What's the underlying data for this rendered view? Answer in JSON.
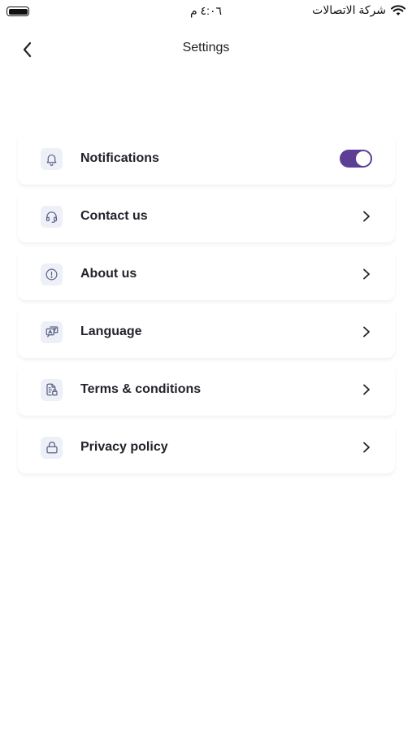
{
  "status_bar": {
    "time": "٤:٠٦ م",
    "carrier": "شركة الاتصالات"
  },
  "header": {
    "title": "Settings"
  },
  "colors": {
    "accent": "#5c3e95",
    "icon_bg": "#eef0f8",
    "icon_stroke": "#5a5f86"
  },
  "settings": {
    "items": [
      {
        "label": "Notifications",
        "icon": "bell-icon",
        "control": "toggle",
        "enabled": true
      },
      {
        "label": "Contact us",
        "icon": "headphones-icon",
        "control": "chevron"
      },
      {
        "label": "About us",
        "icon": "info-circle-icon",
        "control": "chevron"
      },
      {
        "label": "Language",
        "icon": "translate-icon",
        "control": "chevron"
      },
      {
        "label": "Terms & conditions",
        "icon": "document-lock-icon",
        "control": "chevron"
      },
      {
        "label": "Privacy policy",
        "icon": "lock-icon",
        "control": "chevron"
      }
    ]
  }
}
